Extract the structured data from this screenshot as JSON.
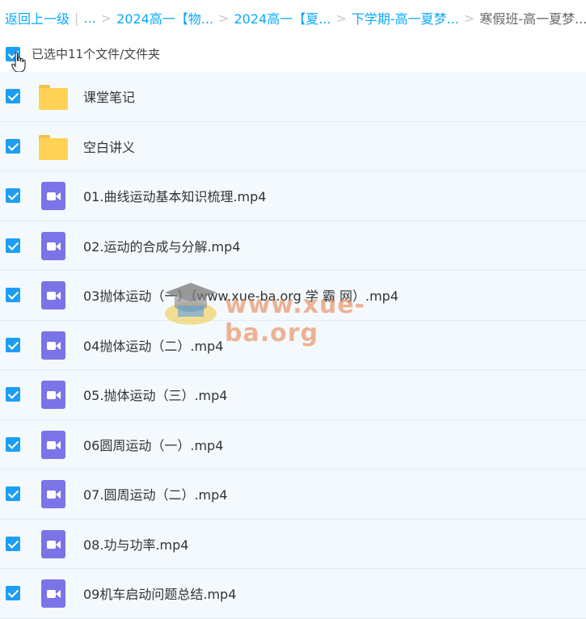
{
  "breadcrumb": {
    "back": "返回上一级",
    "ellipsis": "...",
    "items": [
      "2024高一【物...",
      "2024高一【夏...",
      "下学期-高一夏梦..."
    ],
    "current": "寒假班-高一夏梦..."
  },
  "selection": {
    "label": "已选中11个文件/文件夹"
  },
  "files": [
    {
      "name": "课堂笔记",
      "type": "folder",
      "checked": true
    },
    {
      "name": "空白讲义",
      "type": "folder",
      "checked": true
    },
    {
      "name": "01.曲线运动基本知识梳理.mp4",
      "type": "video",
      "checked": true
    },
    {
      "name": "02.运动的合成与分解.mp4",
      "type": "video",
      "checked": true
    },
    {
      "name": "03抛体运动（一）（www.xue-ba.org 学 霸 网）.mp4",
      "type": "video",
      "checked": true
    },
    {
      "name": "04抛体运动（二）.mp4",
      "type": "video",
      "checked": true
    },
    {
      "name": "05.抛体运动（三）.mp4",
      "type": "video",
      "checked": true
    },
    {
      "name": "06圆周运动（一）.mp4",
      "type": "video",
      "checked": true
    },
    {
      "name": "07.圆周运动（二）.mp4",
      "type": "video",
      "checked": true
    },
    {
      "name": "08.功与功率.mp4",
      "type": "video",
      "checked": true
    },
    {
      "name": "09机车启动问题总结.mp4",
      "type": "video",
      "checked": true
    }
  ],
  "watermark": {
    "text": "www.xue-ba.org"
  },
  "colors": {
    "accent": "#1d9ef4",
    "link": "#09aaff",
    "folder": "#ffd154",
    "video": "#7b73e8",
    "row_bg": "#f4f9fd"
  }
}
